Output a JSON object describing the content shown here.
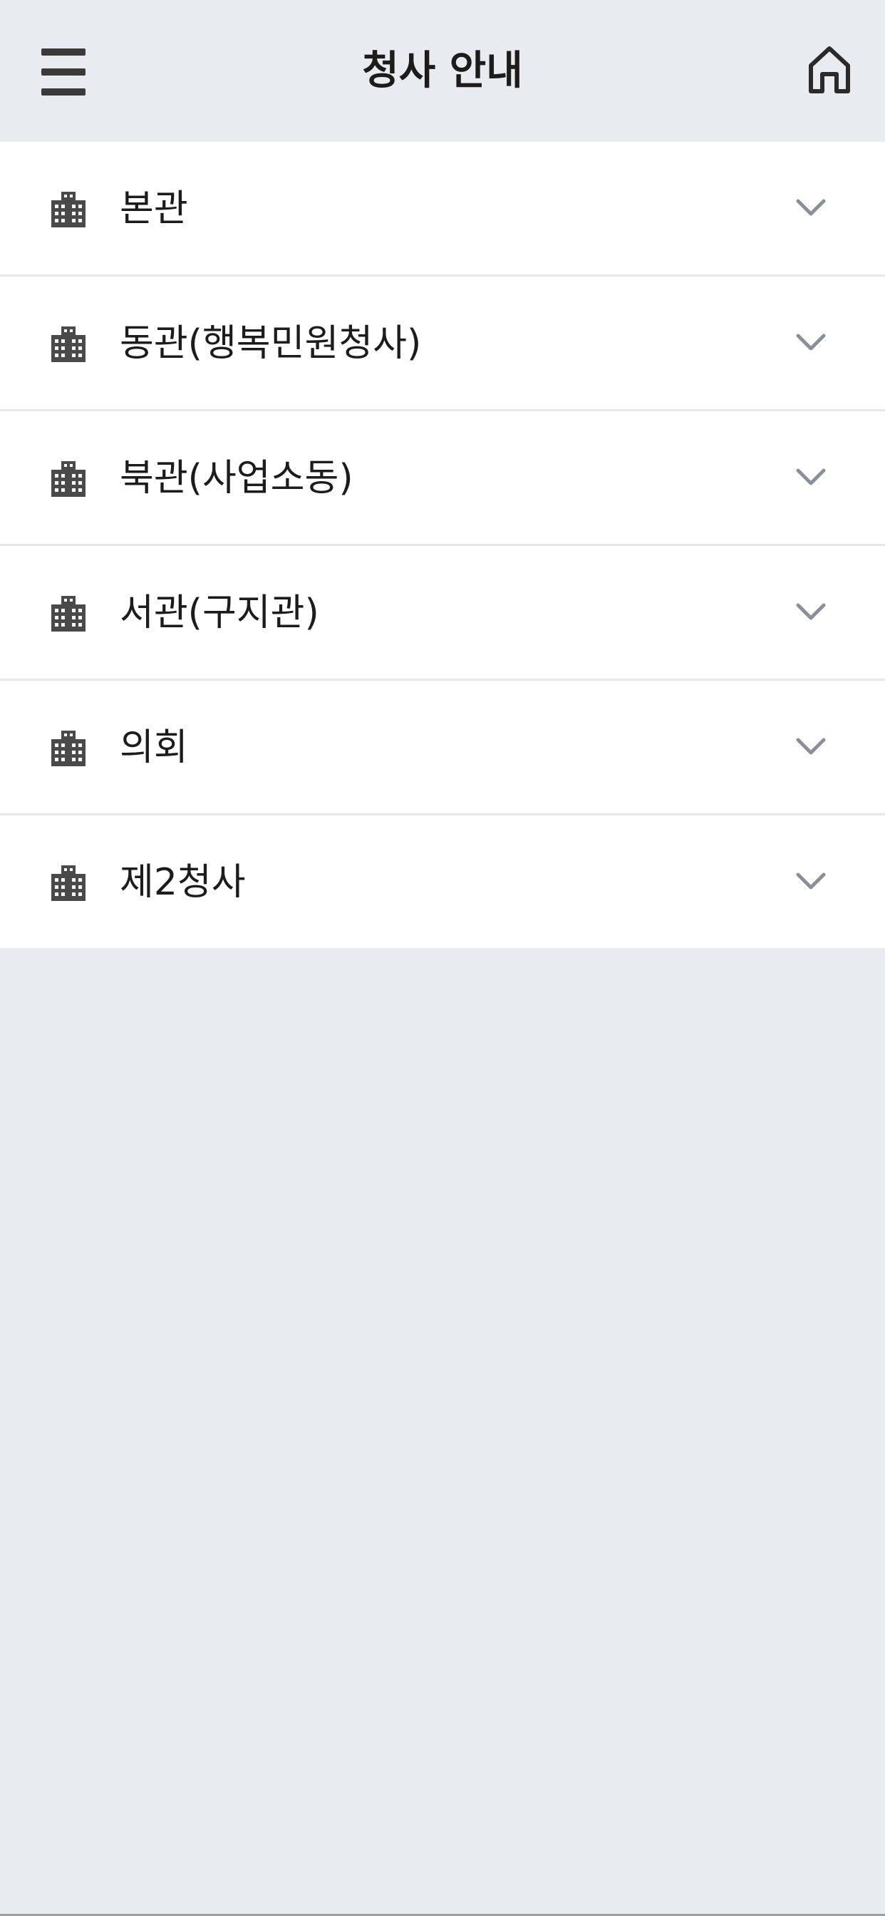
{
  "header": {
    "title": "청사 안내",
    "menu_icon": "hamburger-menu-icon",
    "home_icon": "home-icon"
  },
  "buildings": [
    {
      "label": "본관",
      "icon": "building-icon"
    },
    {
      "label": "동관(행복민원청사)",
      "icon": "building-icon"
    },
    {
      "label": "북관(사업소동)",
      "icon": "building-icon"
    },
    {
      "label": "서관(구지관)",
      "icon": "building-icon"
    },
    {
      "label": "의회",
      "icon": "building-icon"
    },
    {
      "label": "제2청사",
      "icon": "building-icon"
    }
  ],
  "colors": {
    "background": "#e8ebf0",
    "item_background": "#ffffff",
    "text": "#1c1c1c",
    "icon": "#4a4a4a",
    "chevron": "#8a9099"
  }
}
